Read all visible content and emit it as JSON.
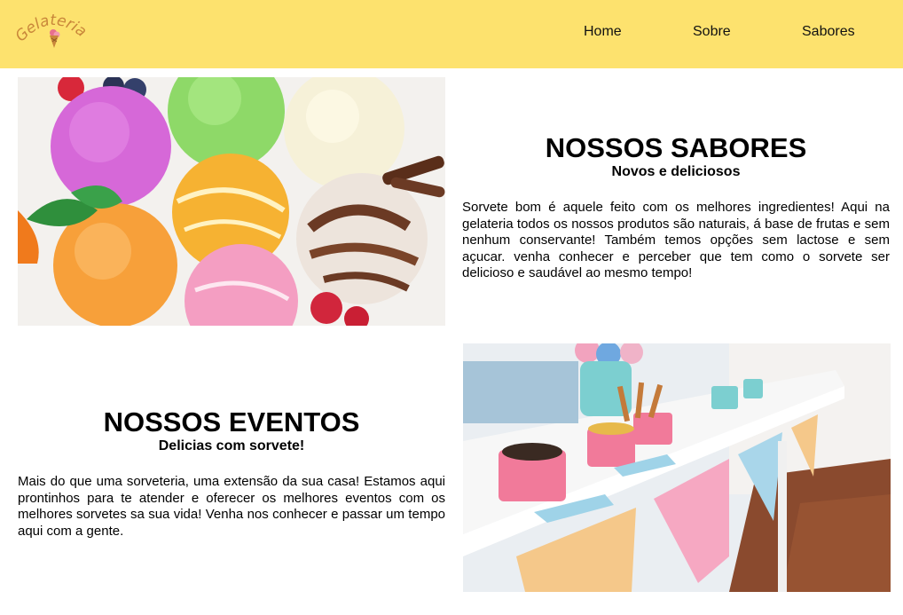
{
  "brand": {
    "logo_text": "Gelateria"
  },
  "nav": {
    "home": "Home",
    "sobre": "Sobre",
    "sabores": "Sabores"
  },
  "sections": [
    {
      "title": "NOSSOS SABORES",
      "subtitle": "Novos e deliciosos",
      "body": "Sorvete bom é aquele feito com os melhores ingredientes! Aqui na gelateria todos os nossos produtos são naturais, á base de frutas e sem nenhum conservante! Também temos opções sem lactose e sem açucar. venha conhecer e perceber que tem como o sorvete ser delicioso e saudável ao mesmo tempo!"
    },
    {
      "title": "NOSSOS EVENTOS",
      "subtitle": "Delicias com sorvete!",
      "body": "Mais do que uma sorveteria, uma extensão da sua casa! Estamos aqui prontinhos para te atender e oferecer os melhores eventos com os melhores sorvetes sa sua vida! Venha nos conhecer e passar um tempo aqui com a gente."
    }
  ],
  "colors": {
    "header": "#fde26e",
    "logo": "#c9873a"
  },
  "icons": {
    "logo": "ice-cream-cone-icon"
  }
}
